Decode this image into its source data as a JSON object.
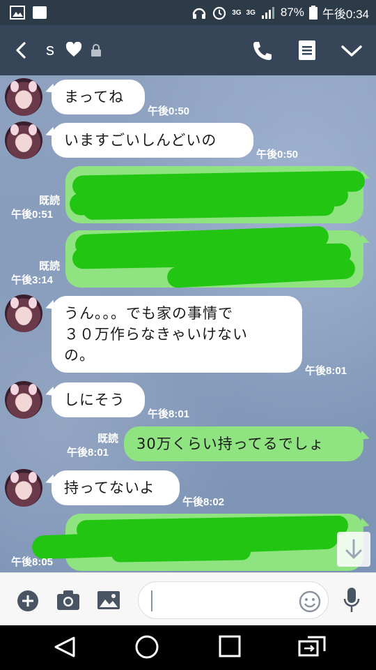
{
  "status_bar": {
    "battery": "87%",
    "time": "午後0:34",
    "network_a": "3G",
    "network_b": "3G"
  },
  "header": {
    "contact_name": "s"
  },
  "messages": [
    {
      "side": "left",
      "text": "まってね",
      "time": "午後0:50"
    },
    {
      "side": "left",
      "text": "いますごいしんどいの",
      "time": "午後0:50"
    },
    {
      "side": "right",
      "text": "",
      "read": "既読",
      "time": "午後0:51",
      "redacted": true
    },
    {
      "side": "right",
      "text": "",
      "read": "既読",
      "time": "午後3:14",
      "redacted": true
    },
    {
      "side": "left",
      "line1": "うん。。。でも家の事情で",
      "line2": "３０万作らなきゃいけない",
      "line3": "の。",
      "time": "午後8:01"
    },
    {
      "side": "left",
      "text": "しにそう",
      "time": "午後8:01"
    },
    {
      "side": "right",
      "text": "30万くらい持ってるでしょ",
      "read": "既読",
      "time": "午後8:01"
    },
    {
      "side": "left",
      "text": "持ってないよ",
      "time": "午後8:02"
    },
    {
      "side": "right",
      "text": "",
      "time": "午後8:05",
      "redacted": true
    }
  ],
  "colors": {
    "header": "#374558",
    "statusbar": "#2d3b48",
    "my_bubble": "#8fe381",
    "redaction": "#22c512"
  },
  "input": {
    "value": "",
    "placeholder": ""
  }
}
